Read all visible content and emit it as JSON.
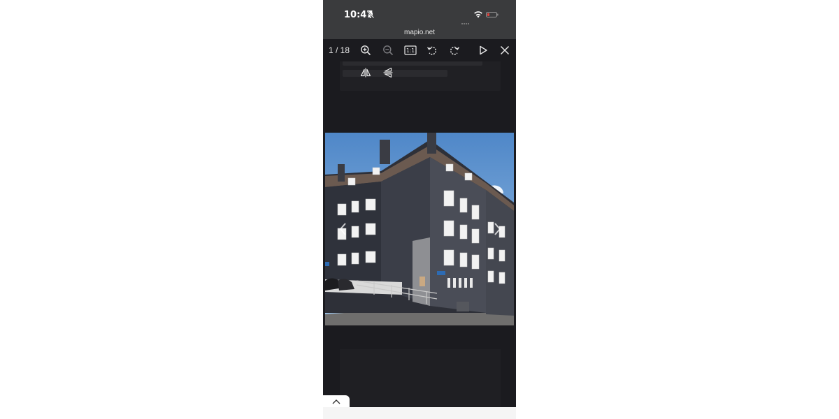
{
  "status_bar": {
    "time": "10:47",
    "icons": [
      "bell-slash-icon",
      "signal-icon",
      "wifi-icon",
      "battery-low-icon"
    ]
  },
  "browser": {
    "url": "mapio.net"
  },
  "viewer": {
    "counter": "1 / 18",
    "toolbar_icons": [
      "zoom-in-icon",
      "zoom-out-icon",
      "actual-size-icon",
      "rotate-left-icon",
      "rotate-right-icon",
      "play-icon",
      "close-icon"
    ],
    "actual_size_label": "1:1",
    "secondary_icons": [
      "flip-horizontal-icon",
      "flip-vertical-icon"
    ]
  },
  "colors": {
    "status_bg": "#3a3b3d",
    "viewer_bg": "#1b1b1f",
    "battery": "#e0443e"
  }
}
